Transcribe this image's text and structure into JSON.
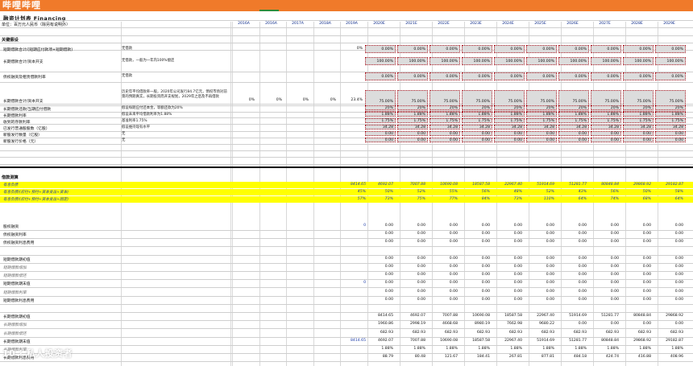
{
  "app": {
    "title": "哔哩哔哩"
  },
  "sheet": {
    "title": "融资计划表 Financing",
    "unit": "单位：百万元人民币（除另有说明外）"
  },
  "years": [
    "2016A",
    "2016A",
    "2017A",
    "2018A",
    "2019A",
    "2020E",
    "2021E",
    "2022E",
    "2023E",
    "2024E",
    "2025E",
    "2026E",
    "2027E",
    "2028E",
    "2029E"
  ],
  "section1": {
    "title": "关键假设"
  },
  "assumptions": [
    {
      "label": "短期借款合计/(短期应付款项+短期借款)",
      "note": "无借款",
      "hist": [
        "",
        "",
        "",
        "",
        "0%"
      ],
      "proj": [
        "0.00%",
        "0.00%",
        "0.00%",
        "0.00%",
        "0.00%",
        "0.00%",
        "0.00%",
        "0.00%",
        "0.00%",
        "0.00%"
      ]
    },
    {
      "label": "长期借款合计/资本开支",
      "note": "无借款，一般为一年内100%偿还",
      "hist": [
        "",
        "",
        "",
        "",
        ""
      ],
      "proj": [
        "100.00%",
        "100.00%",
        "100.00%",
        "100.00%",
        "100.00%",
        "100.00%",
        "100.00%",
        "100.00%",
        "100.00%",
        "100.00%"
      ]
    },
    {
      "label": "债权融资及租赁借款利率",
      "note": "无借款",
      "hist": [
        "",
        "",
        "",
        "",
        ""
      ],
      "proj": [
        "0.00%",
        "0.00%",
        "0.00%",
        "0.00%",
        "0.00%",
        "0.00%",
        "0.00%",
        "0.00%",
        "0.00%",
        "0.00%"
      ]
    },
    {
      "label": "长期借款合计/资本开支",
      "note": "历史年平均借款率一般，2020年公司发行84.7亿元，债权市场对前景的预期真实，长期投资而开支规划，2029年之后及不再借款",
      "hist": [
        "0%",
        "0%",
        "0%",
        "0%",
        "23.4%"
      ],
      "proj": [
        "75.00%",
        "75.00%",
        "75.00%",
        "75.00%",
        "75.00%",
        "75.00%",
        "75.00%",
        "75.00%",
        "75.00%",
        "75.00%"
      ]
    }
  ],
  "assumptions2": [
    {
      "label": "长期借款还款/当期应付借款",
      "note": "假设每期应付还本金，等额还款为20%",
      "proj": [
        "20%",
        "20%",
        "20%",
        "20%",
        "20%",
        "20%",
        "20%",
        "20%",
        "20%",
        "20%"
      ]
    },
    {
      "label": "长期借款利率",
      "note": "假设未来平均借款利率为1.88%",
      "proj": [
        "1.88%",
        "1.88%",
        "1.88%",
        "1.88%",
        "1.88%",
        "1.88%",
        "1.88%",
        "1.88%",
        "1.88%",
        "1.88%"
      ]
    },
    {
      "label": "收到的存款利率",
      "note": "基准利率1.75%",
      "proj": [
        "1.75%",
        "1.75%",
        "1.75%",
        "1.75%",
        "1.75%",
        "1.75%",
        "1.75%",
        "1.75%",
        "1.75%",
        "1.75%"
      ]
    },
    {
      "label": "已发行普通股股数（亿股）",
      "note": "假设维持现有水平",
      "proj": [
        "34.28",
        "34.28",
        "34.28",
        "34.28",
        "34.28",
        "34.28",
        "34.28",
        "34.28",
        "34.28",
        "34.28"
      ]
    },
    {
      "label": "新股发行数量（亿股）",
      "note": "无",
      "proj": [
        "0.00",
        "0.00",
        "0.00",
        "0.00",
        "0.00",
        "0.00",
        "0.00",
        "0.00",
        "0.00",
        "0.00"
      ]
    },
    {
      "label": "新股发行价格（元）",
      "note": "无",
      "proj": [
        "0.00",
        "0.00",
        "0.00",
        "0.00",
        "0.00",
        "0.00",
        "0.00",
        "0.00",
        "0.00",
        "0.00"
      ]
    }
  ],
  "section2": {
    "title": "借款测算"
  },
  "yellow": [
    {
      "label": "有息负债",
      "v2019": "8414.65",
      "proj": [
        "4692.07",
        "7007.88",
        "10690.08",
        "18587.58",
        "22967.40",
        "51914.69",
        "51281.77",
        "80848.84",
        "29868.92",
        "29182.87"
      ]
    },
    {
      "label": "有息负债/(应付+预付+资本支出+资本)",
      "v2019": "45%",
      "proj": [
        "50%",
        "52%",
        "55%",
        "56%",
        "48%",
        "52%",
        "43%",
        "56%",
        "50%",
        "58%"
      ]
    },
    {
      "label": "有息负债/(应付+预付+资本支出+固定)",
      "v2019": "57%",
      "proj": [
        "73%",
        "75%",
        "77%",
        "84%",
        "73%",
        "110%",
        "64%",
        "74%",
        "68%",
        "64%"
      ]
    }
  ],
  "loans": [
    {
      "label": "股权融资",
      "ital": false,
      "v2019": "0",
      "proj": [
        "0.00",
        "0.00",
        "0.00",
        "0.00",
        "0.00",
        "0.00",
        "0.00",
        "0.00",
        "0.00",
        "0.00"
      ]
    },
    {
      "label": "债权融资利率",
      "ital": false,
      "v2019": "",
      "proj": [
        "0.00",
        "0.00",
        "0.00",
        "0.00",
        "0.00",
        "0.00",
        "0.00",
        "0.00",
        "0.00",
        "0.00"
      ]
    },
    {
      "label": "债权融资利息费用",
      "ital": false,
      "v2019": "",
      "proj": [
        "0.00",
        "0.00",
        "0.00",
        "0.00",
        "0.00",
        "0.00",
        "0.00",
        "0.00",
        "0.00",
        "0.00"
      ]
    },
    {
      "label": "",
      "ital": false,
      "v2019": "",
      "proj": [
        "",
        "",
        "",
        "",
        "",
        "",
        "",
        "",
        "",
        ""
      ]
    },
    {
      "label": "短期借款期初值",
      "ital": false,
      "v2019": "",
      "proj": [
        "0.00",
        "0.00",
        "0.00",
        "0.00",
        "0.00",
        "0.00",
        "0.00",
        "0.00",
        "0.00",
        "0.00"
      ]
    },
    {
      "label": "短期借款增加",
      "ital": true,
      "v2019": "",
      "proj": [
        "0.00",
        "0.00",
        "0.00",
        "0.00",
        "0.00",
        "0.00",
        "0.00",
        "0.00",
        "0.00",
        "0.00"
      ]
    },
    {
      "label": "短期借款偿还",
      "ital": true,
      "v2019": "",
      "proj": [
        "0.00",
        "0.00",
        "0.00",
        "0.00",
        "0.00",
        "0.00",
        "0.00",
        "0.00",
        "0.00",
        "0.00"
      ]
    },
    {
      "label": "短期借款期末值",
      "ital": false,
      "v2019": "0",
      "proj": [
        "0.00",
        "0.00",
        "0.00",
        "0.00",
        "0.00",
        "0.00",
        "0.00",
        "0.00",
        "0.00",
        "0.00"
      ]
    },
    {
      "label": "短期借款利率",
      "ital": true,
      "v2019": "",
      "proj": [
        "0.00",
        "0.00",
        "0.00",
        "0.00",
        "0.00",
        "0.00",
        "0.00",
        "0.00",
        "0.00",
        "0.00"
      ]
    },
    {
      "label": "短期借款利息费用",
      "ital": false,
      "v2019": "",
      "proj": [
        "0.00",
        "0.00",
        "0.00",
        "0.00",
        "0.00",
        "0.00",
        "0.00",
        "0.00",
        "0.00",
        "0.00"
      ]
    },
    {
      "label": "",
      "ital": false,
      "v2019": "",
      "proj": [
        "",
        "",
        "",
        "",
        "",
        "",
        "",
        "",
        "",
        ""
      ]
    },
    {
      "label": "长期借款期初值",
      "ital": false,
      "v2019": "",
      "proj": [
        "8414.65",
        "4692.07",
        "7007.88",
        "10690.08",
        "18587.58",
        "22967.40",
        "51914.69",
        "51281.77",
        "80848.84",
        "29868.92"
      ]
    },
    {
      "label": "长期借款增加",
      "ital": true,
      "v2019": "",
      "proj": [
        "1960.86",
        "2998.19",
        "4668.68",
        "8980.19",
        "7662.98",
        "9680.22",
        "0.00",
        "0.00",
        "0.00",
        "0.00"
      ]
    },
    {
      "label": "长期借款偿还",
      "ital": true,
      "v2019": "",
      "proj": [
        "682.93",
        "682.93",
        "682.93",
        "682.93",
        "682.93",
        "682.93",
        "682.93",
        "682.93",
        "682.93",
        "682.93"
      ]
    },
    {
      "label": "长期借款期末值",
      "ital": false,
      "v2019": "8414.65",
      "proj": [
        "4692.07",
        "7007.88",
        "10690.08",
        "18587.58",
        "22967.40",
        "51914.69",
        "51281.77",
        "80848.84",
        "29868.92",
        "29182.87"
      ]
    },
    {
      "label": "长期借款利率",
      "ital": true,
      "v2019": "",
      "proj": [
        "1.88%",
        "1.88%",
        "1.88%",
        "1.88%",
        "1.88%",
        "1.88%",
        "1.88%",
        "1.88%",
        "1.88%",
        "1.88%"
      ]
    },
    {
      "label": "长期借款利息费用",
      "ital": false,
      "v2019": "",
      "proj": [
        "88.79",
        "80.48",
        "121.67",
        "184.41",
        "267.81",
        "877.81",
        "484.18",
        "424.74",
        "416.88",
        "408.96"
      ]
    }
  ],
  "watermark": "10 · 私人投资者"
}
